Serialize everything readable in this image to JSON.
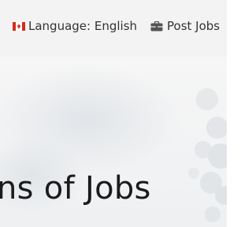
{
  "topbar": {
    "language": {
      "label": "Language: English",
      "icon": "canada-flag-icon"
    },
    "post_jobs": {
      "label": "Post Jobs",
      "icon": "briefcase-icon"
    }
  },
  "hero": {
    "heading": "ns of Jobs"
  },
  "colors": {
    "topbar_bg": "#f3f3f3",
    "heading_text": "#1b1b1b",
    "flag_red": "#d52b1e"
  }
}
